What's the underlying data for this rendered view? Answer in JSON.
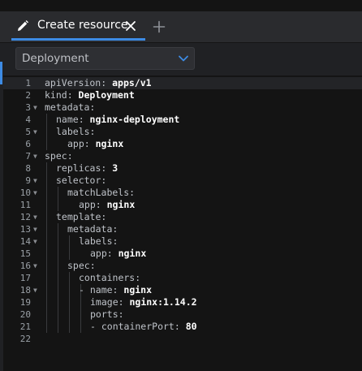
{
  "tab": {
    "label": "Create resource",
    "close_icon": "close-icon",
    "add_icon": "plus-icon",
    "edit_icon": "pencil-icon"
  },
  "resource_select": {
    "value": "Deployment",
    "icon": "chevron-down-icon"
  },
  "editor": {
    "active_line": 1,
    "lines": [
      {
        "n": "1",
        "fold": false,
        "indent": 0,
        "key": "apiVersion:",
        "val": " apps/v1"
      },
      {
        "n": "2",
        "fold": false,
        "indent": 0,
        "key": "kind:",
        "val": " Deployment"
      },
      {
        "n": "3",
        "fold": true,
        "indent": 0,
        "key": "metadata:",
        "val": ""
      },
      {
        "n": "4",
        "fold": false,
        "indent": 2,
        "key": "name:",
        "val": " nginx-deployment"
      },
      {
        "n": "5",
        "fold": true,
        "indent": 2,
        "key": "labels:",
        "val": ""
      },
      {
        "n": "6",
        "fold": false,
        "indent": 4,
        "key": "app:",
        "val": " nginx"
      },
      {
        "n": "7",
        "fold": true,
        "indent": 0,
        "key": "spec:",
        "val": ""
      },
      {
        "n": "8",
        "fold": false,
        "indent": 2,
        "key": "replicas:",
        "val": " 3"
      },
      {
        "n": "9",
        "fold": true,
        "indent": 2,
        "key": "selector:",
        "val": ""
      },
      {
        "n": "10",
        "fold": true,
        "indent": 4,
        "key": "matchLabels:",
        "val": ""
      },
      {
        "n": "11",
        "fold": false,
        "indent": 6,
        "key": "app:",
        "val": " nginx"
      },
      {
        "n": "12",
        "fold": true,
        "indent": 2,
        "key": "template:",
        "val": ""
      },
      {
        "n": "13",
        "fold": true,
        "indent": 4,
        "key": "metadata:",
        "val": ""
      },
      {
        "n": "14",
        "fold": true,
        "indent": 6,
        "key": "labels:",
        "val": ""
      },
      {
        "n": "15",
        "fold": false,
        "indent": 8,
        "key": "app:",
        "val": " nginx"
      },
      {
        "n": "16",
        "fold": true,
        "indent": 4,
        "key": "spec:",
        "val": ""
      },
      {
        "n": "17",
        "fold": false,
        "indent": 6,
        "key": "containers:",
        "val": ""
      },
      {
        "n": "18",
        "fold": true,
        "indent": 6,
        "key": "- name:",
        "val": " nginx"
      },
      {
        "n": "19",
        "fold": false,
        "indent": 8,
        "key": "image:",
        "val": " nginx:1.14.2"
      },
      {
        "n": "20",
        "fold": false,
        "indent": 8,
        "key": "ports:",
        "val": ""
      },
      {
        "n": "21",
        "fold": false,
        "indent": 8,
        "key": "- containerPort:",
        "val": " 80"
      },
      {
        "n": "22",
        "fold": false,
        "indent": 0,
        "key": "",
        "val": ""
      }
    ]
  }
}
